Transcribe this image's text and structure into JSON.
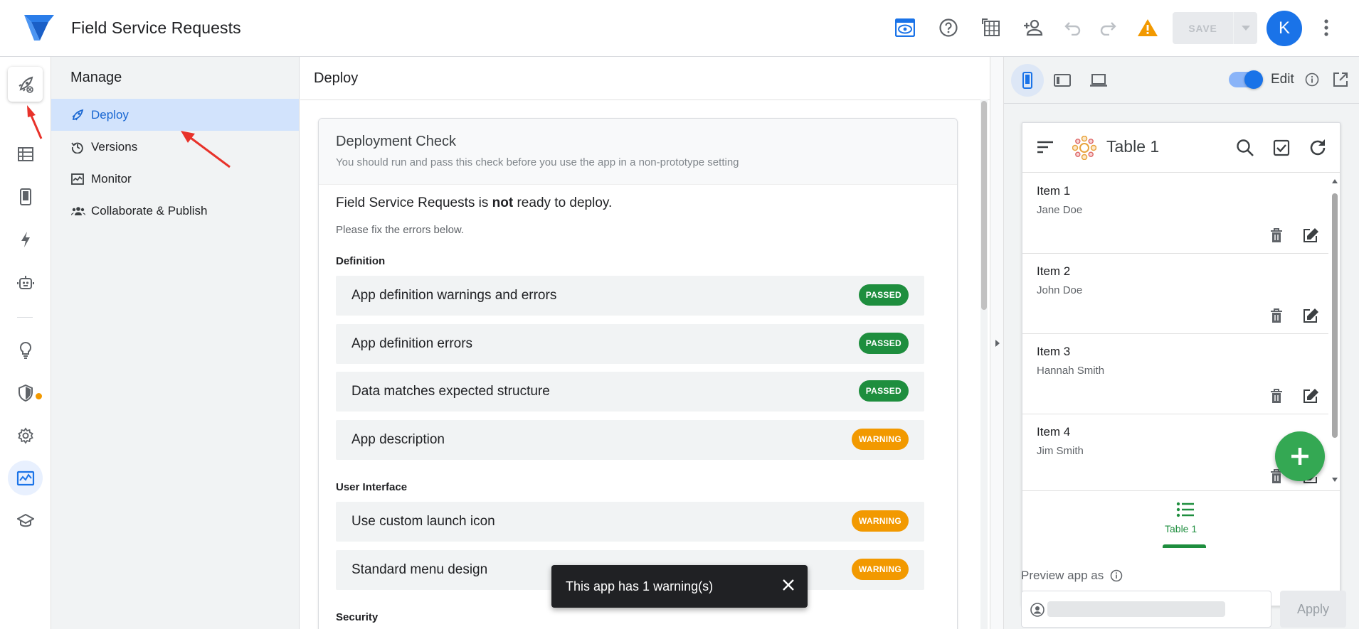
{
  "app": {
    "title": "Field Service Requests"
  },
  "topbar": {
    "icons": [
      "preview-eye-icon",
      "help-icon",
      "table-view-icon",
      "add-person-icon",
      "undo-icon",
      "redo-icon",
      "warning-icon"
    ],
    "save_label": "SAVE",
    "avatar_initial": "K"
  },
  "rail": {
    "items": [
      "rocket-icon",
      "data-table-icon",
      "mobile-icon",
      "lightning-icon",
      "bot-icon",
      "lightbulb-icon",
      "shield-icon",
      "gear-icon",
      "monitor-icon",
      "school-icon"
    ]
  },
  "manage": {
    "title": "Manage",
    "items": [
      {
        "label": "Deploy",
        "icon": "rocket-icon",
        "active": true
      },
      {
        "label": "Versions",
        "icon": "history-icon"
      },
      {
        "label": "Monitor",
        "icon": "monitor-icon"
      },
      {
        "label": "Collaborate & Publish",
        "icon": "people-icon"
      }
    ]
  },
  "main": {
    "title": "Deploy",
    "card": {
      "title": "Deployment Check",
      "subtitle": "You should run and pass this check before you use the app in a non-prototype setting",
      "status_prefix": "Field Service Requests is ",
      "status_emph": "not",
      "status_suffix": " ready to deploy.",
      "fix_text": "Please fix the errors below.",
      "sections": [
        {
          "label": "Definition",
          "checks": [
            {
              "label": "App definition warnings and errors",
              "status": "PASSED"
            },
            {
              "label": "App definition errors",
              "status": "PASSED"
            },
            {
              "label": "Data matches expected structure",
              "status": "PASSED"
            },
            {
              "label": "App description",
              "status": "WARNING"
            }
          ]
        },
        {
          "label": "User Interface",
          "checks": [
            {
              "label": "Use custom launch icon",
              "status": "WARNING"
            },
            {
              "label": "Standard menu design",
              "status": "WARNING"
            }
          ]
        },
        {
          "label": "Security",
          "checks": []
        }
      ]
    }
  },
  "snackbar": {
    "message": "This app has 1 warning(s)"
  },
  "preview": {
    "edit_label": "Edit",
    "table_title": "Table 1",
    "items": [
      {
        "title": "Item 1",
        "subtitle": "Jane Doe"
      },
      {
        "title": "Item 2",
        "subtitle": "John Doe"
      },
      {
        "title": "Item 3",
        "subtitle": "Hannah Smith"
      },
      {
        "title": "Item 4",
        "subtitle": "Jim Smith"
      }
    ],
    "nav_label": "Table 1",
    "preview_as_label": "Preview app as",
    "apply_label": "Apply"
  },
  "colors": {
    "accent": "#1a73e8",
    "passed": "#1e8e3e",
    "warning": "#f29900",
    "active_nav_bg": "#d2e3fc"
  }
}
